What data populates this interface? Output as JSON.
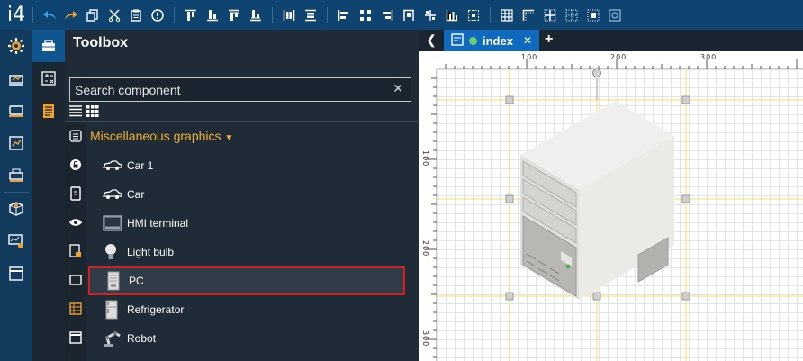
{
  "app": {
    "logo": "i4"
  },
  "toolbar": {
    "icons": [
      "undo-icon",
      "redo-icon",
      "copy-icon",
      "cut-icon",
      "paste-icon",
      "info-icon",
      "align-top-icon",
      "align-bottom-icon",
      "align-middle-top-icon",
      "align-middle-bottom-icon",
      "distribute-h-icon",
      "distribute-v-icon",
      "align-left-icon",
      "align-center-icon",
      "align-right-icon",
      "bring-top-icon",
      "center-h-icon",
      "chart-icon",
      "center-v-icon",
      "grid-icon",
      "corner-icon",
      "grid-fine-icon",
      "grid-dotted-icon",
      "grid-off-icon",
      "zoom-fit-icon"
    ]
  },
  "toolbox": {
    "title": "Toolbox",
    "search_placeholder": "Search component",
    "clear": "✕",
    "category": "Miscellaneous graphics",
    "items": [
      {
        "label": "Car 1"
      },
      {
        "label": "Car"
      },
      {
        "label": "HMI terminal"
      },
      {
        "label": "Light bulb"
      },
      {
        "label": "PC"
      },
      {
        "label": "Refrigerator"
      },
      {
        "label": "Robot"
      }
    ]
  },
  "editor": {
    "back": "❮",
    "tab_label": "index",
    "tab_close": "✕",
    "tab_add": "+",
    "ruler_h": [
      "100",
      "200",
      "300"
    ],
    "ruler_v": [
      "100",
      "200",
      "300"
    ]
  },
  "colors": {
    "accent": "#0f6abf",
    "category": "#f0b030",
    "selection": "#d81e1e"
  }
}
